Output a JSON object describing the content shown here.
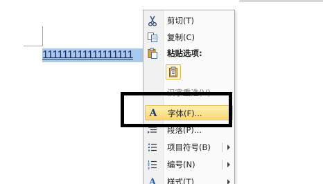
{
  "document": {
    "selected_text": "111111111111111111"
  },
  "context_menu": {
    "cut": "剪切(T)",
    "copy": "复制(C)",
    "paste_options": "粘贴选项:",
    "hanzi_reselect": "汉字重选(V)",
    "font": "字体(F)...",
    "paragraph": "段落(P)...",
    "bullets": "项目符号(B)",
    "numbering": "编号(N)",
    "styles": "样式(T)"
  },
  "colors": {
    "selection": "#a9c9ec",
    "highlight": "#fbd773",
    "annotation_box": "#000000"
  }
}
